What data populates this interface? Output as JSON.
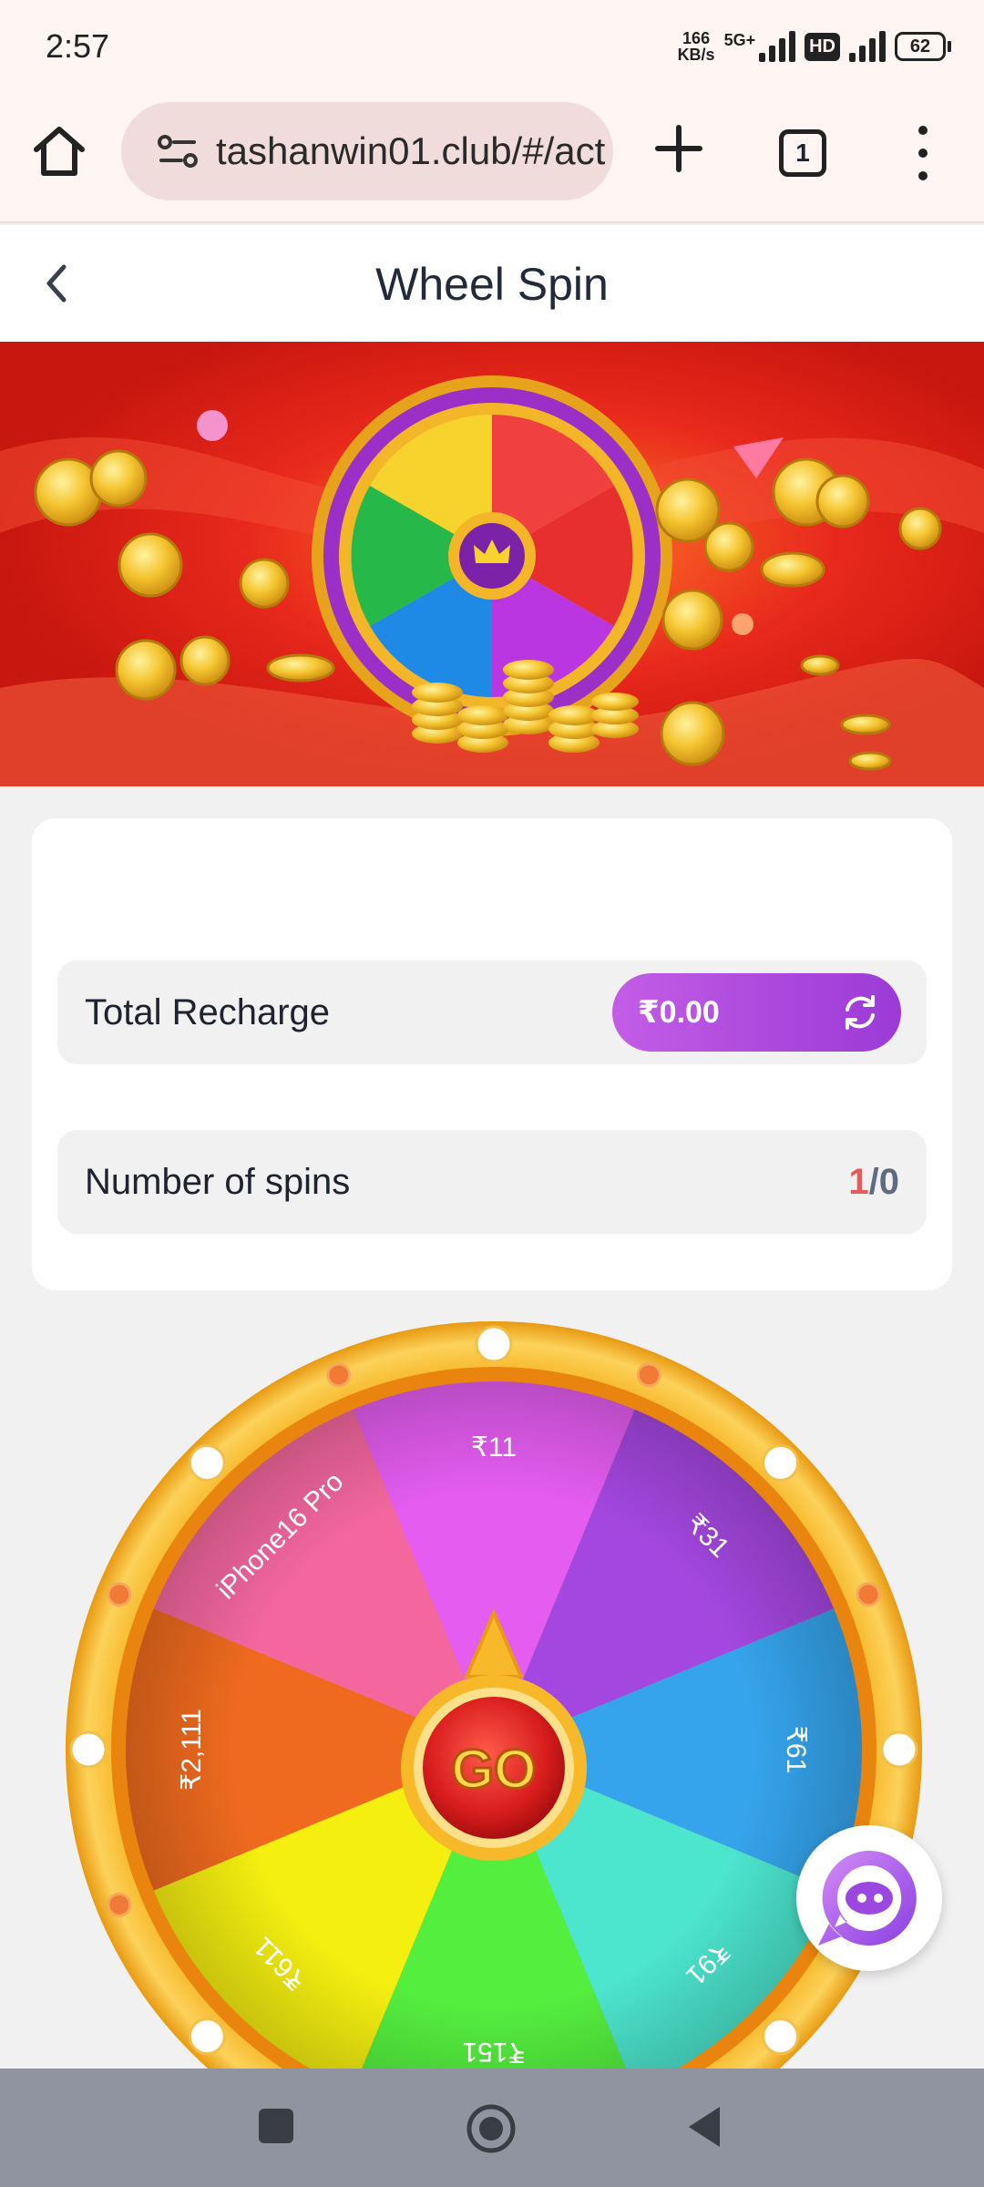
{
  "status_bar": {
    "time": "2:57",
    "net_speed_value": "166",
    "net_speed_unit": "KB/s",
    "network": "5G+",
    "hd": "HD",
    "battery": "62"
  },
  "browser": {
    "url": "tashanwin01.club/#/activity",
    "tab_count": "1"
  },
  "page": {
    "title": "Wheel Spin"
  },
  "recharge": {
    "label": "Total Recharge",
    "amount": "₹0.00"
  },
  "spins": {
    "label": "Number of spins",
    "used": "1",
    "separator": "/",
    "total": "0"
  },
  "wheel": {
    "go_label": "GO",
    "segments": [
      {
        "label": "₹11",
        "color": "#e45cf0"
      },
      {
        "label": "₹31",
        "color": "#a447e0"
      },
      {
        "label": "₹61",
        "color": "#35a4ec"
      },
      {
        "label": "₹91",
        "color": "#4ce6cf"
      },
      {
        "label": "₹151",
        "color": "#54ee3e"
      },
      {
        "label": "₹611",
        "color": "#f5ef10"
      },
      {
        "label": "₹2,111",
        "color": "#ef6a1e"
      },
      {
        "label": "iPhone16 Pro",
        "color": "#f4679e"
      }
    ]
  },
  "colors": {
    "accent_purple": "#9b3ad6",
    "wheel_rim": "#f7b82a",
    "banner_red": "#e0241b"
  }
}
